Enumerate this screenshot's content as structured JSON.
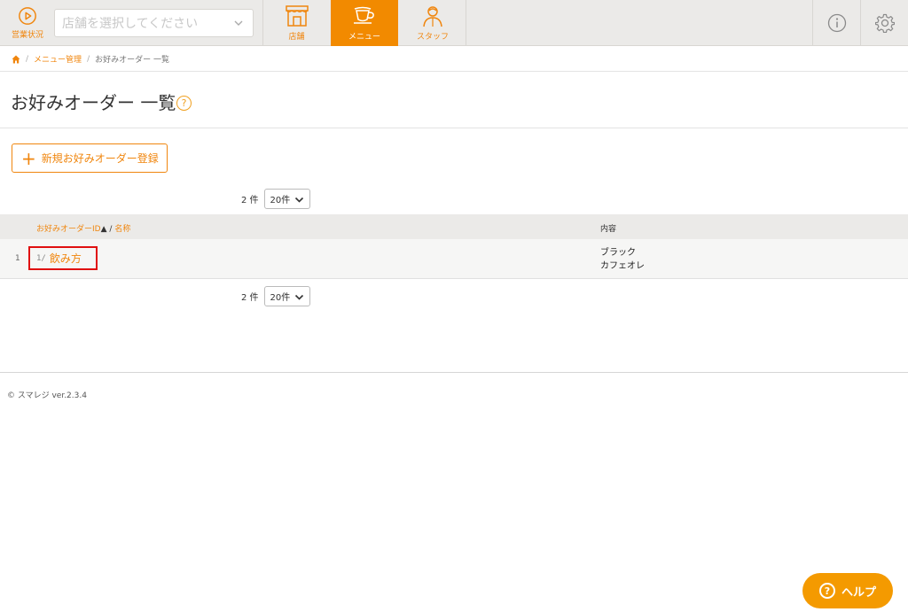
{
  "topbar": {
    "status_label": "営業状況",
    "store_placeholder": "店舗を選択してください",
    "tabs": [
      {
        "label": "店舗",
        "icon": "store-icon",
        "active": false
      },
      {
        "label": "メニュー",
        "icon": "cup-icon",
        "active": true
      },
      {
        "label": "スタッフ",
        "icon": "staff-icon",
        "active": false
      }
    ],
    "accent": "#f0860e"
  },
  "breadcrumb": {
    "items": [
      "メニュー管理",
      "お好みオーダー 一覧"
    ]
  },
  "page": {
    "title": "お好みオーダー 一覧",
    "help_mark": "?",
    "add_button": "新規お好みオーダー登録"
  },
  "pager": {
    "count": "2 件",
    "per_page": "20件"
  },
  "table": {
    "header_id_name": "お好みオーダーID",
    "sort_mark": "▲",
    "header_sep": "/",
    "header_name": "名称",
    "header_content": "内容",
    "rows": [
      {
        "num": "1",
        "id": "1/",
        "name": "飲み方",
        "content": [
          "ブラック",
          "カフェオレ"
        ]
      }
    ]
  },
  "footer": {
    "copyright": "© スマレジ ver.2.3.4"
  },
  "help_button": {
    "label": "ヘルプ",
    "mark": "?"
  }
}
